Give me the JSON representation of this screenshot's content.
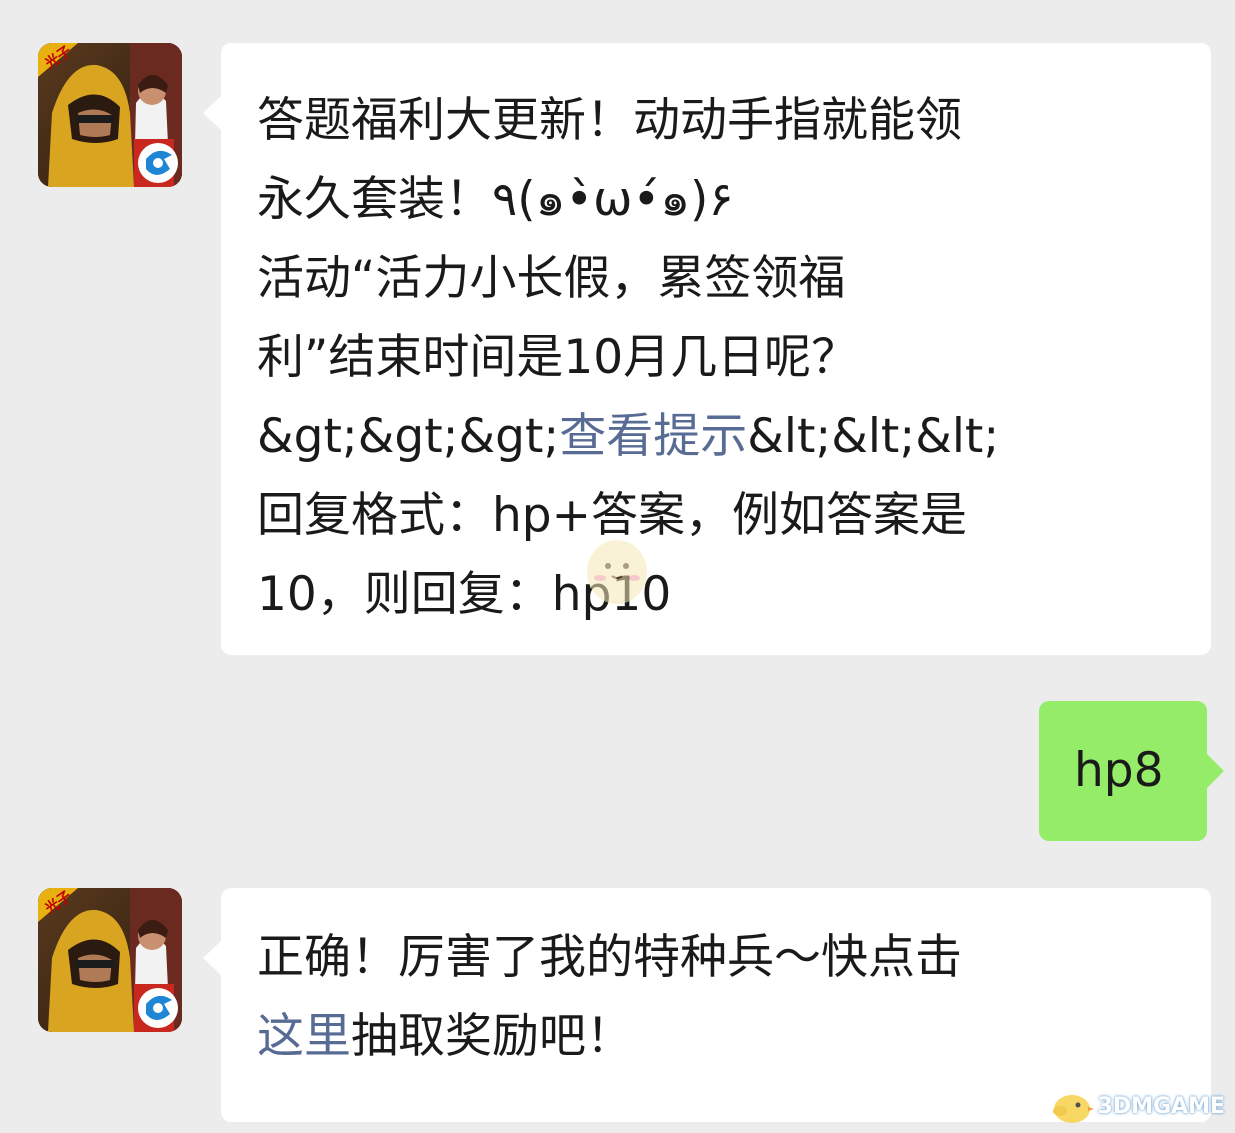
{
  "messages": [
    {
      "from": "official-account",
      "lines": [
        {
          "text": "答题福利大更新！动动手指就能领"
        },
        {
          "text": "永久套装！٩(๑•̀ω•́๑)۶"
        },
        {
          "text": "活动“活力小长假，累签领福"
        },
        {
          "text": "利”结束时间是10月几日呢？"
        },
        {
          "prefix": "&gt;&gt;&gt;",
          "link": "查看提示",
          "suffix": "&lt;&lt;&lt;"
        },
        {
          "text": "回复格式：hp+答案，例如答案是"
        },
        {
          "text": "10，则回复：hp10"
        }
      ]
    },
    {
      "from": "user",
      "text": "hp8"
    },
    {
      "from": "official-account",
      "line1": "正确！厉害了我的特种兵～快点击",
      "line2_link": "这里",
      "line2_rest": "抽取奖励吧！"
    }
  ],
  "avatar": {
    "badge_text": "光子",
    "icon": "game-app-icon"
  },
  "watermark": {
    "text": "3DMGAME"
  },
  "colors": {
    "background": "#ececec",
    "incoming_bubble": "#ffffff",
    "outgoing_bubble": "#95ec69",
    "link": "#576b95"
  }
}
